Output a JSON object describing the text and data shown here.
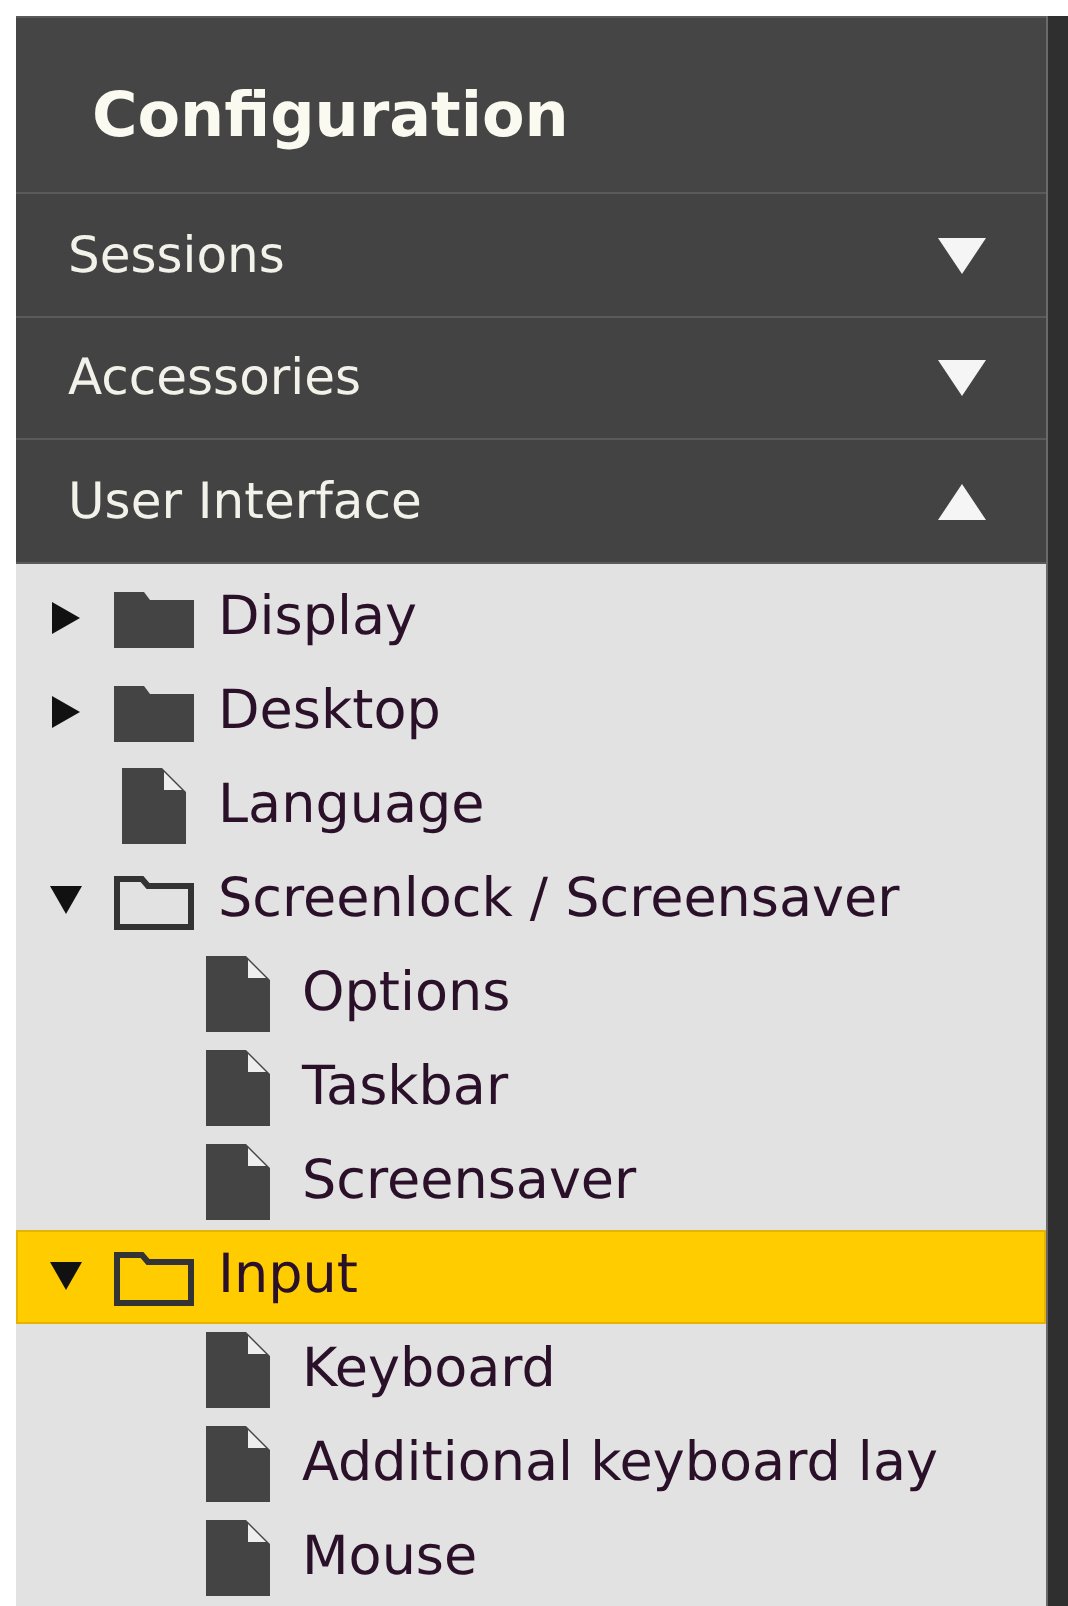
{
  "panel": {
    "title": "Configuration"
  },
  "sections": [
    {
      "label": "Sessions",
      "expanded": false
    },
    {
      "label": "Accessories",
      "expanded": false
    },
    {
      "label": "User Interface",
      "expanded": true
    }
  ],
  "tree": [
    {
      "label": "Display",
      "kind": "folder",
      "expanded": false,
      "selected": false
    },
    {
      "label": "Desktop",
      "kind": "folder",
      "expanded": false,
      "selected": false
    },
    {
      "label": "Language",
      "kind": "file",
      "selected": false
    },
    {
      "label": "Screenlock / Screensaver",
      "kind": "folder",
      "expanded": true,
      "selected": false,
      "children": [
        {
          "label": "Options",
          "kind": "file",
          "selected": false
        },
        {
          "label": "Taskbar",
          "kind": "file",
          "selected": false
        },
        {
          "label": "Screensaver",
          "kind": "file",
          "selected": false
        }
      ]
    },
    {
      "label": "Input",
      "kind": "folder",
      "expanded": true,
      "selected": true,
      "children": [
        {
          "label": "Keyboard",
          "kind": "file",
          "selected": false
        },
        {
          "label": "Additional keyboard lay",
          "kind": "file",
          "selected": false
        },
        {
          "label": "Mouse",
          "kind": "file",
          "selected": false
        }
      ]
    }
  ]
}
